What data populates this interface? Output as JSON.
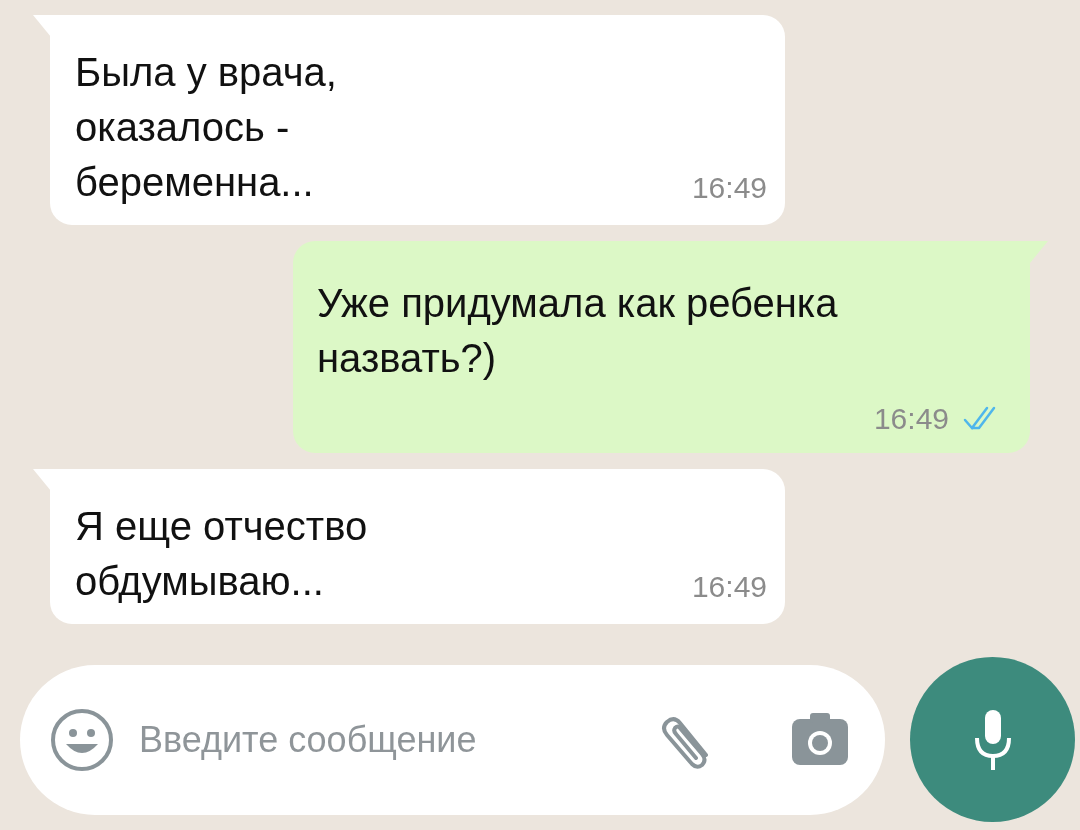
{
  "messages": [
    {
      "kind": "incoming",
      "text": "Была у врача,\nоказалось -\nбеременна...",
      "time": "16:49"
    },
    {
      "kind": "outgoing",
      "text": "Уже придумала как ребенка\nназвать?)",
      "time": "16:49",
      "read": true
    },
    {
      "kind": "incoming",
      "text": "Я еще отчество\nобдумываю...",
      "time": "16:49"
    }
  ],
  "composer": {
    "placeholder": "Введите сообщение"
  }
}
